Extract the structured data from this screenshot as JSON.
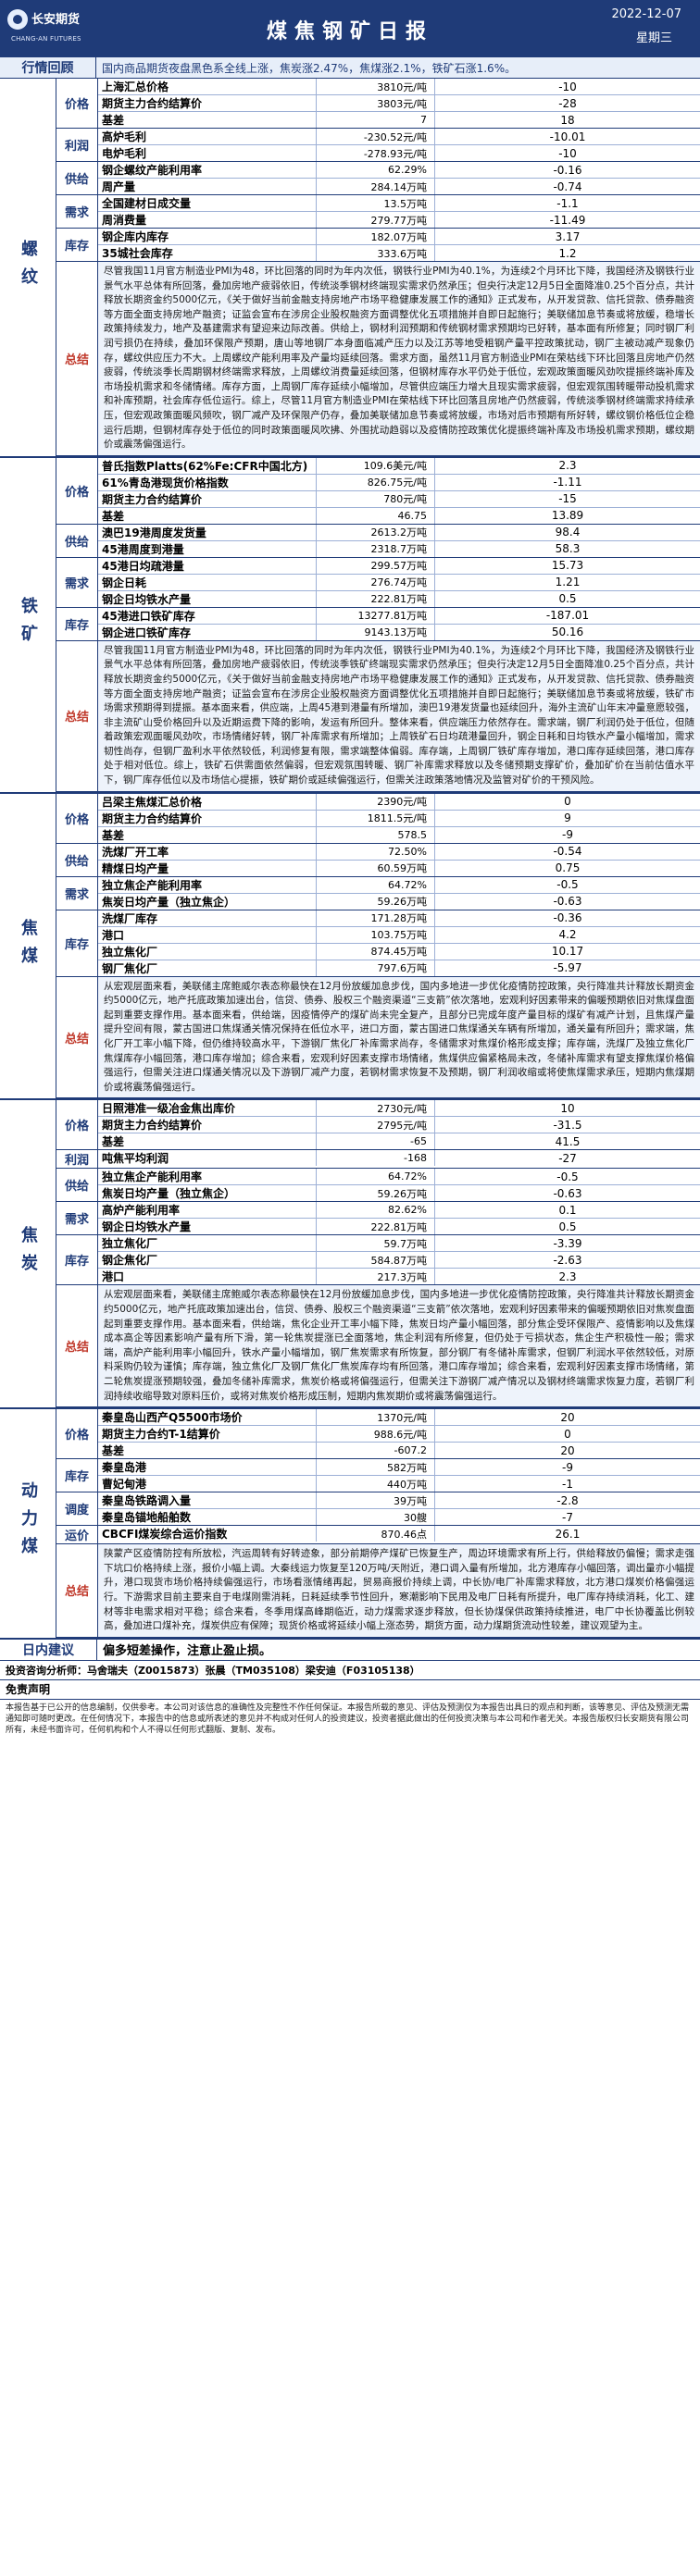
{
  "header": {
    "logo_cn": "长安期货",
    "logo_en": "CHANG-AN FUTURES",
    "title": "煤焦钢矿日报",
    "date": "2022-12-07",
    "weekday": "星期三"
  },
  "market_review": {
    "label": "行情回顾",
    "text": "国内商品期货夜盘黑色系全线上涨，焦炭涨2.47%，焦煤涨2.1%，铁矿石涨1.6%。"
  },
  "sections": [
    {
      "name": "螺纹",
      "groups": [
        {
          "label": "价格",
          "rows": [
            {
              "name": "上海汇总价格",
              "value": "3810元/吨",
              "change": "-10"
            },
            {
              "name": "期货主力合约结算价",
              "value": "3803元/吨",
              "change": "-28"
            },
            {
              "name": "基差",
              "value": "7",
              "change": "18"
            }
          ]
        },
        {
          "label": "利润",
          "rows": [
            {
              "name": "高炉毛利",
              "value": "-230.52元/吨",
              "change": "-10.01"
            },
            {
              "name": "电炉毛利",
              "value": "-278.93元/吨",
              "change": "-10"
            }
          ]
        },
        {
          "label": "供给",
          "rows": [
            {
              "name": "钢企螺纹产能利用率",
              "value": "62.29%",
              "change": "-0.16"
            },
            {
              "name": "周产量",
              "value": "284.14万吨",
              "change": "-0.74"
            }
          ]
        },
        {
          "label": "需求",
          "rows": [
            {
              "name": "全国建材日成交量",
              "value": "13.5万吨",
              "change": "-1.1"
            },
            {
              "name": "周消费量",
              "value": "279.77万吨",
              "change": "-11.49"
            }
          ]
        },
        {
          "label": "库存",
          "rows": [
            {
              "name": "钢企库内库存",
              "value": "182.07万吨",
              "change": "3.17"
            },
            {
              "name": "35城社会库存",
              "value": "333.6万吨",
              "change": "1.2"
            }
          ]
        }
      ],
      "summary_label": "总结",
      "summary": "尽管我国11月官方制造业PMI为48，环比回落的同时为年内次低，钢铁行业PMI为40.1%，为连续2个月环比下降，我国经济及钢铁行业景气水平总体有所回落，叠加房地产疲弱依旧，传统淡季钢材终端现实需求仍然承压；但央行决定12月5日全面降准0.25个百分点，共计释放长期资金约5000亿元，《关于做好当前金融支持房地产市场平稳健康发展工作的通知》正式发布，从开发贷款、信托贷款、债券融资等方面全面支持房地产融资；证监会宣布在涉房企业股权融资方面调整优化五项措施并自即日起施行；美联储加息节奏或将放缓，稳增长政策持续发力，地产及基建需求有望迎来边际改善。供给上，钢材利润预期和传统钢材需求预期均已好转，基本面有所修复；同时钢厂利润亏损仍在持续，叠加环保限产预期，唐山等地钢厂本身面临减产压力以及江苏等地受粗钢产量平控政策扰动，钢厂主被动减产现象仍存，螺纹供应压力不大。上周螺纹产能利用率及产量均延续回落。需求方面，虽然11月官方制造业PMI在荣枯线下环比回落且房地产仍然疲弱，传统淡季长周期钢材终端需求释放，上周螺纹消费量延续回落，但钢材库存水平仍处于低位，宏观政策面暖风劲吹提振终端补库及市场投机需求和冬储情绪。库存方面，上周钢厂库存延续小幅增加，尽管供应端压力增大且现实需求疲弱，但宏观氛围转暖带动投机需求和补库预期，社会库存低位运行。综上，尽管11月官方制造业PMI在荣枯线下环比回落且房地产仍然疲弱，传统淡季钢材终端需求持续承压，但宏观政策面暖风频吹，钢厂减产及环保限产仍存，叠加美联储加息节奏或将放缓，市场对后市预期有所好转，螺纹钢价格低位企稳运行后期，但钢材库存处于低位的同时政策面暖风吹拂、外围扰动趋弱以及疫情防控政策优化提振终端补库及市场投机需求预期，螺纹期价或震荡偏强运行。"
    },
    {
      "name": "铁矿",
      "groups": [
        {
          "label": "价格",
          "rows": [
            {
              "name": "普氏指数Platts(62%Fe:CFR中国北方)",
              "value": "109.6美元/吨",
              "change": "2.3"
            },
            {
              "name": "61%青岛港现货价格指数",
              "value": "826.75元/吨",
              "change": "-1.11"
            },
            {
              "name": "期货主力合约结算价",
              "value": "780元/吨",
              "change": "-15"
            },
            {
              "name": "基差",
              "value": "46.75",
              "change": "13.89"
            }
          ]
        },
        {
          "label": "供给",
          "rows": [
            {
              "name": "澳巴19港周度发货量",
              "value": "2613.2万吨",
              "change": "98.4"
            },
            {
              "name": "45港周度到港量",
              "value": "2318.7万吨",
              "change": "58.3"
            }
          ]
        },
        {
          "label": "需求",
          "rows": [
            {
              "name": "45港日均疏港量",
              "value": "299.57万吨",
              "change": "15.73"
            },
            {
              "name": "钢企日耗",
              "value": "276.74万吨",
              "change": "1.21"
            },
            {
              "name": "钢企日均铁水产量",
              "value": "222.81万吨",
              "change": "0.5"
            }
          ]
        },
        {
          "label": "库存",
          "rows": [
            {
              "name": "45港进口铁矿库存",
              "value": "13277.81万吨",
              "change": "-187.01"
            },
            {
              "name": "钢企进口铁矿库存",
              "value": "9143.13万吨",
              "change": "50.16"
            }
          ]
        }
      ],
      "summary_label": "总结",
      "summary": "尽管我国11月官方制造业PMI为48，环比回落的同时为年内次低，钢铁行业PMI为40.1%，为连续2个月环比下降，我国经济及钢铁行业景气水平总体有所回落，叠加房地产疲弱依旧，传统淡季铁矿终端现实需求仍然承压；但央行决定12月5日全面降准0.25个百分点，共计释放长期资金约5000亿元，《关于做好当前金融支持房地产市场平稳健康发展工作的通知》正式发布，从开发贷款、信托贷款、债券融资等方面全面支持房地产融资；证监会宣布在涉房企业股权融资方面调整优化五项措施并自即日起施行；美联储加息节奏或将放缓，铁矿市场需求预期得到提振。基本面来看，供应端，上周45港到港量有所增加，澳巴19港发货量也延续回升，海外主流矿山年末冲量意愿较强，非主流矿山受价格回升以及近期运费下降的影响，发运有所回升。整体来看，供应端压力依然存在。需求端，钢厂利润仍处于低位，但随着政策宏观面暖风劲吹，市场情绪好转，钢厂补库需求有所增加；上周铁矿石日均疏港量回升，钢企日耗和日均铁水产量小幅增加，需求韧性尚存，但钢厂盈利水平依然较低，利润修复有限，需求端整体偏弱。库存端，上周钢厂铁矿库存增加，港口库存延续回落，港口库存处于相对低位。综上，铁矿石供需面依然偏弱，但宏观氛围转暖、钢厂补库需求释放以及冬储预期支撑矿价，叠加矿价在当前估值水平下，钢厂库存低位以及市场信心提振，铁矿期价或延续偏强运行，但需关注政策落地情况及监管对矿价的干预风险。"
    },
    {
      "name": "焦煤",
      "groups": [
        {
          "label": "价格",
          "rows": [
            {
              "name": "吕梁主焦煤汇总价格",
              "value": "2390元/吨",
              "change": "0"
            },
            {
              "name": "期货主力合约结算价",
              "value": "1811.5元/吨",
              "change": "9"
            },
            {
              "name": "基差",
              "value": "578.5",
              "change": "-9"
            }
          ]
        },
        {
          "label": "供给",
          "rows": [
            {
              "name": "洗煤厂开工率",
              "value": "72.50%",
              "change": "-0.54"
            },
            {
              "name": "精煤日均产量",
              "value": "60.59万吨",
              "change": "0.75"
            }
          ]
        },
        {
          "label": "需求",
          "rows": [
            {
              "name": "独立焦企产能利用率",
              "value": "64.72%",
              "change": "-0.5"
            },
            {
              "name": "焦炭日均产量（独立焦企）",
              "value": "59.26万吨",
              "change": "-0.63"
            }
          ]
        },
        {
          "label": "库存",
          "rows": [
            {
              "name": "洗煤厂库存",
              "value": "171.28万吨",
              "change": "-0.36"
            },
            {
              "name": "港口",
              "value": "103.75万吨",
              "change": "4.2"
            },
            {
              "name": "独立焦化厂",
              "value": "874.45万吨",
              "change": "10.17"
            },
            {
              "name": "钢厂焦化厂",
              "value": "797.6万吨",
              "change": "-5.97"
            }
          ]
        }
      ],
      "summary_label": "总结",
      "summary": "从宏观层面来看，美联储主席鲍威尔表态称最快在12月份放缓加息步伐，国内多地进一步优化疫情防控政策，央行降准共计释放长期资金约5000亿元，地产托底政策加速出台，信贷、债券、股权三个融资渠道“三支箭”依次落地，宏观利好因素带来的偏暖预期依旧对焦煤盘面起到重要支撑作用。基本面来看，供给端，因疫情停产的煤矿尚未完全复产，且部分已完成年度产量目标的煤矿有减产计划，且焦煤产量提升空间有限，蒙古国进口焦煤通关情况保持在低位水平，进口方面，蒙古国进口焦煤通关车辆有所增加，通关量有所回升；需求端，焦化厂开工率小幅下降，但仍维持较高水平，下游钢厂焦化厂补库需求尚存，冬储需求对焦煤价格形成支撑；库存端，洗煤厂及独立焦化厂焦煤库存小幅回落，港口库存增加；综合来看，宏观利好因素支撑市场情绪，焦煤供应偏紧格局未改，冬储补库需求有望支撑焦煤价格偏强运行，但需关注进口煤通关情况以及下游钢厂减产力度，若钢材需求恢复不及预期，钢厂利润收缩或将使焦煤需求承压，短期内焦煤期价或将震荡偏强运行。"
    },
    {
      "name": "焦炭",
      "groups": [
        {
          "label": "价格",
          "rows": [
            {
              "name": "日照港准一级冶金焦出库价",
              "value": "2730元/吨",
              "change": "10"
            },
            {
              "name": "期货主力合约结算价",
              "value": "2795元/吨",
              "change": "-31.5"
            },
            {
              "name": "基差",
              "value": "-65",
              "change": "41.5"
            }
          ]
        },
        {
          "label": "利润",
          "rows": [
            {
              "name": "吨焦平均利润",
              "value": "-168",
              "change": "-27"
            }
          ]
        },
        {
          "label": "供给",
          "rows": [
            {
              "name": "独立焦企产能利用率",
              "value": "64.72%",
              "change": "-0.5"
            },
            {
              "name": "焦炭日均产量（独立焦企）",
              "value": "59.26万吨",
              "change": "-0.63"
            }
          ]
        },
        {
          "label": "需求",
          "rows": [
            {
              "name": "高炉产能利用率",
              "value": "82.62%",
              "change": "0.1"
            },
            {
              "name": "钢企日均铁水产量",
              "value": "222.81万吨",
              "change": "0.5"
            }
          ]
        },
        {
          "label": "库存",
          "rows": [
            {
              "name": "独立焦化厂",
              "value": "59.7万吨",
              "change": "-3.39"
            },
            {
              "name": "钢企焦化厂",
              "value": "584.87万吨",
              "change": "-2.63"
            },
            {
              "name": "港口",
              "value": "217.3万吨",
              "change": "2.3"
            }
          ]
        }
      ],
      "summary_label": "总结",
      "summary": "从宏观层面来看，美联储主席鲍威尔表态称最快在12月份放缓加息步伐，国内多地进一步优化疫情防控政策，央行降准共计释放长期资金约5000亿元，地产托底政策加速出台，信贷、债券、股权三个融资渠道“三支箭”依次落地，宏观利好因素带来的偏暖预期依旧对焦炭盘面起到重要支撑作用。基本面来看，供给端，焦化企业开工率小幅下降，焦炭日均产量小幅回落，部分焦企受环保限产、疫情影响以及焦煤成本高企等因素影响产量有所下滑，第一轮焦炭提涨已全面落地，焦企利润有所修复，但仍处于亏损状态，焦企生产积极性一般；需求端，高炉产能利用率小幅回升，铁水产量小幅增加，钢厂焦炭需求有所恢复，部分钢厂有冬储补库需求，但钢厂利润水平依然较低，对原料采购仍较为谨慎；库存端，独立焦化厂及钢厂焦化厂焦炭库存均有所回落，港口库存增加；综合来看，宏观利好因素支撑市场情绪，第二轮焦炭提涨预期较强，叠加冬储补库需求，焦炭价格或将偏强运行，但需关注下游钢厂减产情况以及钢材终端需求恢复力度，若钢厂利润持续收缩导致对原料压价，或将对焦炭价格形成压制，短期内焦炭期价或将震荡偏强运行。"
    },
    {
      "name": "动力煤",
      "groups": [
        {
          "label": "价格",
          "rows": [
            {
              "name": "秦皇岛山西产Q5500市场价",
              "value": "1370元/吨",
              "change": "20"
            },
            {
              "name": "期货主力合约T-1结算价",
              "value": "988.6元/吨",
              "change": "0"
            },
            {
              "name": "基差",
              "value": "-607.2",
              "change": "20"
            }
          ]
        },
        {
          "label": "库存",
          "rows": [
            {
              "name": "秦皇岛港",
              "value": "582万吨",
              "change": "-9"
            },
            {
              "name": "曹妃甸港",
              "value": "440万吨",
              "change": "-1"
            }
          ]
        },
        {
          "label": "调度",
          "rows": [
            {
              "name": "秦皇岛铁路调入量",
              "value": "39万吨",
              "change": "-2.8"
            },
            {
              "name": "秦皇岛锚地船舶数",
              "value": "30艘",
              "change": "-7"
            }
          ]
        },
        {
          "label": "运价",
          "rows": [
            {
              "name": "CBCFI煤炭综合运价指数",
              "value": "870.46点",
              "change": "26.1"
            }
          ]
        }
      ],
      "summary_label": "总结",
      "summary": "陕蒙产区疫情防控有所放松，汽运周转有好转迹象，部分前期停产煤矿已恢复生产，周边环境需求有所上行，供给释放仍偏慢；需求走强下坑口价格持续上涨，报价小幅上调。大秦线运力恢复至120万吨/天附近，港口调入量有所增加，北方港库存小幅回落，调出量亦小幅提升，港口现货市场价格持续偏强运行，市场看涨情绪再起，贸易商报价持续上调，中长协/电厂补库需求释放，北方港口煤炭价格偏强运行。下游需求目前主要来自于电煤刚需消耗，日耗延续季节性回升，寒潮影响下民用及电厂日耗有所提升，电厂库存持续消耗，化工、建材等非电需求相对平稳；综合来看，冬季用煤高峰期临近，动力煤需求逐步释放，但长协煤保供政策持续推进，电厂中长协覆盖比例较高，叠加进口煤补充，煤炭供应有保障；现货价格或将延续小幅上涨态势，期货方面，动力煤期货流动性较差，建议观望为主。"
    }
  ],
  "daily_advice": {
    "label": "日内建议",
    "text": "偏多短差操作，注意止盈止损。"
  },
  "analysts": "投资咨询分析师：马舍瑞夫（Z0015873）张晨（TM035108）梁安迪（F03105138）",
  "disclaimer": {
    "title": "免责声明",
    "text": "本报告基于已公开的信息编制，仅供参考。本公司对该信息的准确性及完整性不作任何保证。本报告所载的意见、评估及预测仅为本报告出具日的观点和判断，该等意见、评估及预测无需通知即可随时更改。在任何情况下，本报告中的信息或所表述的意见并不构成对任何人的投资建议，投资者据此做出的任何投资决策与本公司和作者无关。本报告版权归长安期货有限公司所有，未经书面许可，任何机构和个人不得以任何形式翻版、复制、发布。"
  },
  "colors": {
    "brand": "#1f3b78",
    "accent_red": "#c0392b",
    "band": "#e7eef9"
  }
}
